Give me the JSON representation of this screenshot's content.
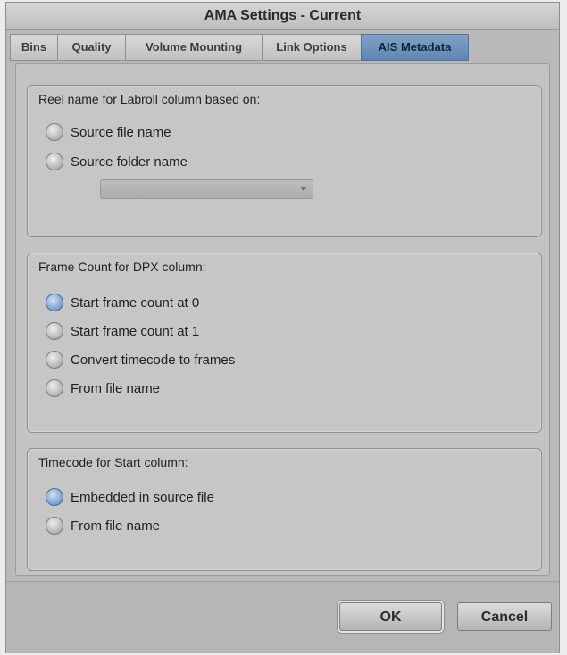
{
  "window": {
    "title": "AMA Settings - Current"
  },
  "tabs": [
    {
      "label": "Bins"
    },
    {
      "label": "Quality"
    },
    {
      "label": "Volume Mounting"
    },
    {
      "label": "Link Options"
    },
    {
      "label": "AIS Metadata",
      "active": true
    }
  ],
  "reel_group": {
    "title": "Reel name for Labroll column based on:",
    "options": [
      {
        "label": "Source file name",
        "selected": false
      },
      {
        "label": "Source folder name",
        "selected": false
      }
    ],
    "dropdown_value": ""
  },
  "frame_group": {
    "title": "Frame Count for DPX column:",
    "options": [
      {
        "label": "Start frame count at 0",
        "selected": true
      },
      {
        "label": "Start frame count at 1",
        "selected": false
      },
      {
        "label": "Convert timecode to frames",
        "selected": false
      },
      {
        "label": "From file name",
        "selected": false
      }
    ]
  },
  "timecode_group": {
    "title": "Timecode for Start column:",
    "options": [
      {
        "label": "Embedded in source file",
        "selected": true
      },
      {
        "label": "From file name",
        "selected": false
      }
    ]
  },
  "buttons": {
    "ok": "OK",
    "cancel": "Cancel"
  },
  "colors": {
    "active_tab": "#6a90b8",
    "selected_radio": "#7aa3cf",
    "panel_bg": "#c3c3c3"
  }
}
